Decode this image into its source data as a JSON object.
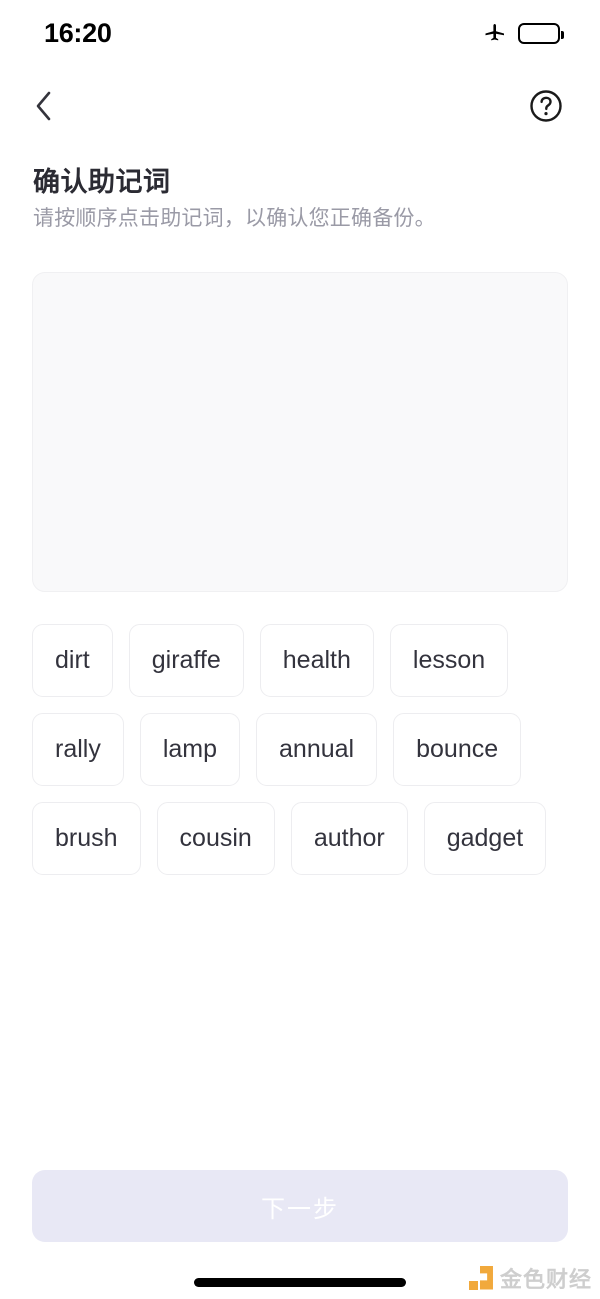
{
  "status_bar": {
    "time": "16:20",
    "airplane_icon": "airplane-mode-icon",
    "battery_icon": "battery-low-power-icon",
    "battery_level_percent": 50,
    "battery_color": "#ffc928"
  },
  "nav": {
    "back_icon": "chevron-left-icon",
    "help_icon": "question-circle-icon"
  },
  "header": {
    "title": "确认助记词",
    "subtitle": "请按顺序点击助记词，以确认您正确备份。"
  },
  "answer_area": {
    "selected_words": [],
    "background_color": "#f9f9fa"
  },
  "word_pool": {
    "words": [
      "dirt",
      "giraffe",
      "health",
      "lesson",
      "rally",
      "lamp",
      "annual",
      "bounce",
      "brush",
      "cousin",
      "author",
      "gadget"
    ]
  },
  "footer": {
    "next_label": "下一步",
    "next_enabled": false,
    "next_background_color": "#e8e8f5",
    "next_text_color": "#ffffff"
  },
  "watermark": {
    "text": "金色财经",
    "logo_color": "#f0a028"
  }
}
